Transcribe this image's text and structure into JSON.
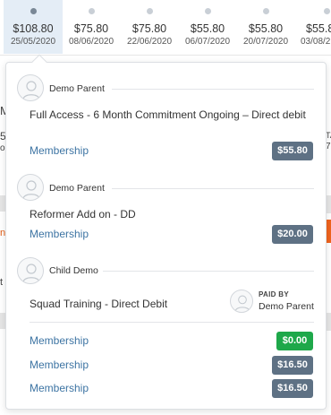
{
  "timeline": [
    {
      "amount": "$108.80",
      "date": "25/05/2020",
      "active": true
    },
    {
      "amount": "$75.80",
      "date": "08/06/2020",
      "active": false
    },
    {
      "amount": "$75.80",
      "date": "22/06/2020",
      "active": false
    },
    {
      "amount": "$55.80",
      "date": "06/07/2020",
      "active": false
    },
    {
      "amount": "$55.80",
      "date": "20/07/2020",
      "active": false
    },
    {
      "amount": "$55.8",
      "date": "03/08/2",
      "active": false
    }
  ],
  "popover": {
    "groups": [
      {
        "person": "Demo Parent",
        "title": "Full Access - 6 Month Commitment Ongoing – Direct debit",
        "lines": [
          {
            "label": "Membership",
            "price": "$55.80",
            "color": "#5e7184"
          }
        ]
      },
      {
        "person": "Demo Parent",
        "title": "Reformer Add on - DD",
        "lines": [
          {
            "label": "Membership",
            "price": "$20.00",
            "color": "#5e7184"
          }
        ]
      },
      {
        "person": "Child Demo",
        "title": "Squad Training - Direct Debit",
        "paid_by_label": "PAID BY",
        "paid_by_name": "Demo Parent",
        "lines": [
          {
            "label": "Membership",
            "price": "$0.00",
            "color": "#1ea84a"
          },
          {
            "label": "Membership",
            "price": "$16.50",
            "color": "#5e7184"
          },
          {
            "label": "Membership",
            "price": "$16.50",
            "color": "#5e7184"
          }
        ]
      }
    ]
  },
  "background": {
    "left_fragments": [
      "M",
      "5.",
      "o",
      "ni",
      "t"
    ],
    "right_fragments": [
      "TA",
      "7"
    ]
  }
}
